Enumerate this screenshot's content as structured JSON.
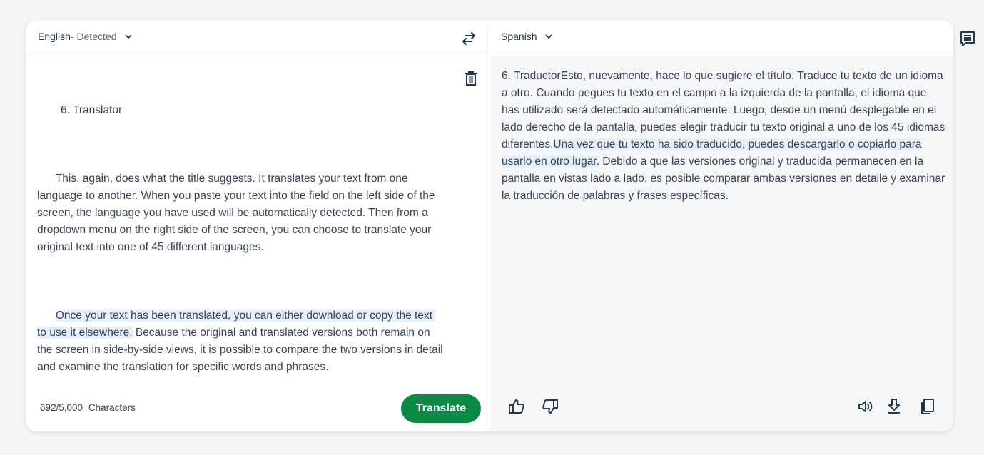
{
  "source": {
    "language_label": "English",
    "detected_suffix": " - Detected",
    "title_line": "6. Translator",
    "paragraph1": "This, again, does what the title suggests. It translates your text from one language to another. When you paste your text into the field on the left side of the screen, the language you have used will be automatically detected. Then from a dropdown menu on the right side of the screen, you can choose to translate your original text into one of 45 different languages.",
    "paragraph2_highlighted": "Once your text has been translated, you can either download or copy the text to use it elsewhere.",
    "paragraph2_rest": " Because the original and translated versions both remain on the screen in side-by-side views, it is possible to compare the two versions in detail and examine the translation for specific words and phrases.",
    "char_count": "692",
    "char_limit": "/5,000",
    "char_label": "Characters",
    "translate_button": "Translate"
  },
  "target": {
    "language_label": "Spanish",
    "text_before": "6. TraductorEsto, nuevamente, hace lo que sugiere el título. Traduce tu texto de un idioma a otro. Cuando pegues tu texto en el campo a la izquierda de la pantalla, el idioma que has utilizado será detectado automáticamente. Luego, desde un menú desplegable en el lado derecho de la pantalla, puedes elegir traducir tu texto original a uno de los 45 idiomas diferentes.",
    "text_highlighted": "Una vez que tu texto ha sido traducido, puedes descargarlo o copiarlo para usarlo en otro lugar.",
    "text_after": " Debido a que las versiones original y traducida permanecen en la pantalla en vistas lado a lado, es posible comparar ambas versiones en detalle y examinar la traducción de palabras y frases específicas."
  },
  "icons": {
    "swap": "swap-arrows-icon",
    "delete": "trash-icon",
    "thumbs_up": "thumbs-up-icon",
    "thumbs_down": "thumbs-down-icon",
    "speaker": "speaker-icon",
    "download": "download-icon",
    "copy": "copy-icon",
    "feedback": "chat-icon"
  },
  "colors": {
    "accent": "#0a8a45",
    "highlight": "#e6f0fc",
    "icon": "#263552"
  }
}
